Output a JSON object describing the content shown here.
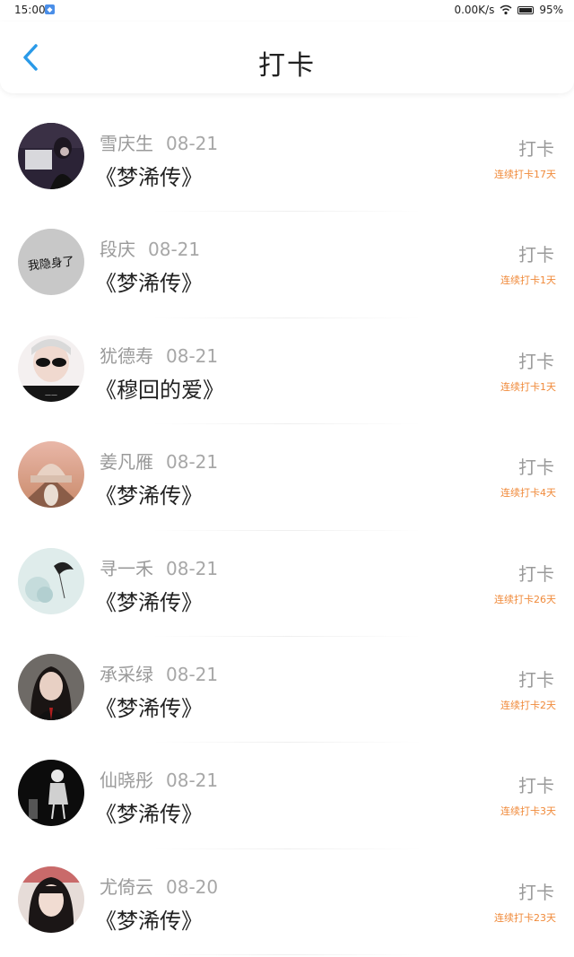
{
  "status_bar": {
    "time": "15:00",
    "network_speed": "0.00K/s",
    "battery": "95%"
  },
  "header": {
    "title": "打卡"
  },
  "colors": {
    "accent": "#2a9ae8",
    "streak": "#f08a3a",
    "muted_text": "#9a9a9a",
    "primary_text": "#222222"
  },
  "entries": [
    {
      "name": "雪庆生",
      "date": "08-21",
      "book": "《梦浠传》",
      "action": "打卡",
      "streak": "连续打卡17天"
    },
    {
      "name": "段庆",
      "date": "08-21",
      "book": "《梦浠传》",
      "action": "打卡",
      "streak": "连续打卡1天",
      "avatar_text": "我隐身了"
    },
    {
      "name": "犹德寿",
      "date": "08-21",
      "book": "《穆回的爱》",
      "action": "打卡",
      "streak": "连续打卡1天"
    },
    {
      "name": "姜凡雁",
      "date": "08-21",
      "book": "《梦浠传》",
      "action": "打卡",
      "streak": "连续打卡4天"
    },
    {
      "name": "寻一禾",
      "date": "08-21",
      "book": "《梦浠传》",
      "action": "打卡",
      "streak": "连续打卡26天"
    },
    {
      "name": "承采绿",
      "date": "08-21",
      "book": "《梦浠传》",
      "action": "打卡",
      "streak": "连续打卡2天"
    },
    {
      "name": "仙晓彤",
      "date": "08-21",
      "book": "《梦浠传》",
      "action": "打卡",
      "streak": "连续打卡3天"
    },
    {
      "name": "尤倚云",
      "date": "08-20",
      "book": "《梦浠传》",
      "action": "打卡",
      "streak": "连续打卡23天"
    }
  ]
}
